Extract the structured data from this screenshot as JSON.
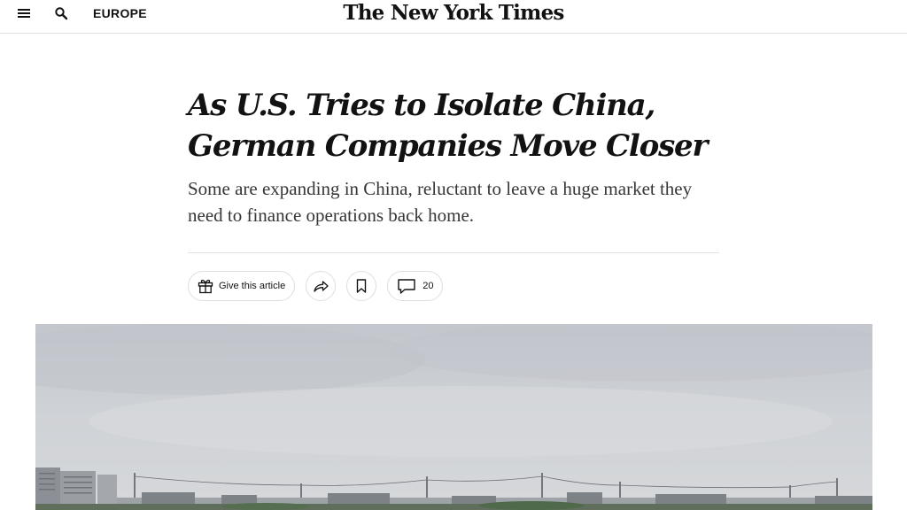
{
  "header": {
    "menu_icon": "hamburger-menu-icon",
    "search_icon": "search-icon",
    "edition": "EUROPE",
    "masthead": "The New York Times"
  },
  "article": {
    "headline": "As U.S. Tries to Isolate China, German Companies Move Closer",
    "summary": "Some are expanding in China, reluctant to leave a huge market they need to finance operations back home."
  },
  "tools": {
    "gift_label": "Give this article",
    "gift_icon": "gift-icon",
    "share_icon": "share-icon",
    "bookmark_icon": "bookmark-icon",
    "comment_icon": "comment-icon",
    "comment_count": "20"
  },
  "lead_image": {
    "subject": "industrial-skyline-photo"
  },
  "colors": {
    "text": "#121212",
    "summary": "#363636",
    "border": "#e2e2e2",
    "sky": "#c9ccd0"
  }
}
